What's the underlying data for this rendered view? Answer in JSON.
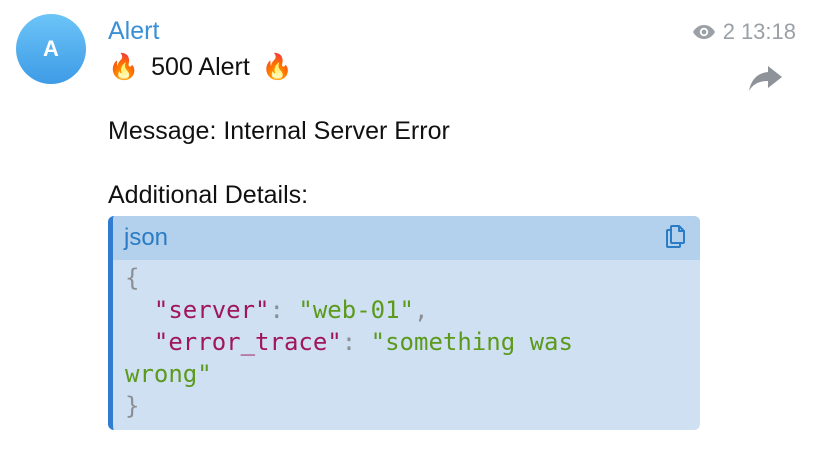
{
  "avatar": {
    "initial": "A"
  },
  "sender": {
    "name": "Alert"
  },
  "meta": {
    "views": "2",
    "time": "13:18"
  },
  "headline": {
    "emoji_left": "🔥",
    "text": "500 Alert",
    "emoji_right": "🔥"
  },
  "message": {
    "text": "Message: Internal Server Error"
  },
  "details": {
    "label": "Additional Details:"
  },
  "code": {
    "language": "json",
    "open_brace": "{",
    "line1": {
      "indent": "  ",
      "key": "\"server\"",
      "colon": ": ",
      "value": "\"web-01\"",
      "comma": ","
    },
    "line2": {
      "indent": "  ",
      "key": "\"error_trace\"",
      "colon": ": ",
      "value_part1": "\"something was",
      "value_part2": "wrong\""
    },
    "close_brace": "}"
  },
  "colors": {
    "accent": "#3a8fd6",
    "code_border": "#2f7cd0",
    "code_bg": "#cfe0f3",
    "code_header_bg": "#b3d0ec",
    "json_key": "#a0165c",
    "json_string": "#5b9a1c"
  },
  "icons": {
    "views": "eye-icon",
    "forward": "forward-arrow-icon",
    "copy": "copy-icon"
  }
}
